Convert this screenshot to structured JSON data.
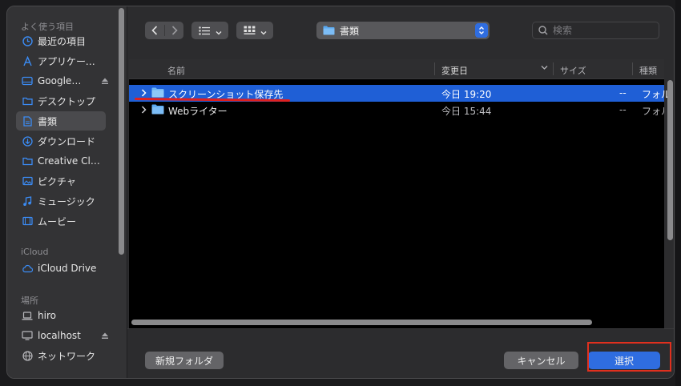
{
  "sidebar": {
    "favorites_title": "よく使う項目",
    "favorites": [
      {
        "label": "最近の項目",
        "icon": "clock-icon"
      },
      {
        "label": "アプリケーシ…",
        "icon": "apps-icon"
      },
      {
        "label": "Google…",
        "icon": "drive-icon"
      },
      {
        "label": "デスクトップ",
        "icon": "desktop-icon"
      },
      {
        "label": "書類",
        "icon": "document-icon"
      },
      {
        "label": "ダウンロード",
        "icon": "download-icon"
      },
      {
        "label": "Creative Clo…",
        "icon": "folder-icon"
      },
      {
        "label": "ピクチャ",
        "icon": "photo-icon"
      },
      {
        "label": "ミュージック",
        "icon": "music-icon"
      },
      {
        "label": "ムービー",
        "icon": "film-icon"
      }
    ],
    "icloud_title": "iCloud",
    "icloud": [
      {
        "label": "iCloud Drive",
        "icon": "cloud-icon"
      }
    ],
    "locations_title": "場所",
    "locations": [
      {
        "label": "hiro",
        "icon": "laptop-icon"
      },
      {
        "label": "localhost",
        "icon": "display-icon"
      },
      {
        "label": "ネットワーク",
        "icon": "globe-icon"
      }
    ]
  },
  "toolbar": {
    "path_label": "書類",
    "search_placeholder": "検索"
  },
  "columns": {
    "name": "名前",
    "modified": "変更日",
    "size": "サイズ",
    "kind": "種類"
  },
  "rows": [
    {
      "name": "スクリーンショット保存先",
      "modified": "今日 19:20",
      "size": "--",
      "kind": "フォル"
    },
    {
      "name": "Webライター",
      "modified": "今日 15:44",
      "size": "--",
      "kind": "フォル"
    }
  ],
  "footer": {
    "new_folder": "新規フォルダ",
    "cancel": "キャンセル",
    "select": "選択"
  },
  "colors": {
    "accent": "#2f6de0",
    "selection": "#1f5fd6",
    "annotation": "#e02020"
  }
}
